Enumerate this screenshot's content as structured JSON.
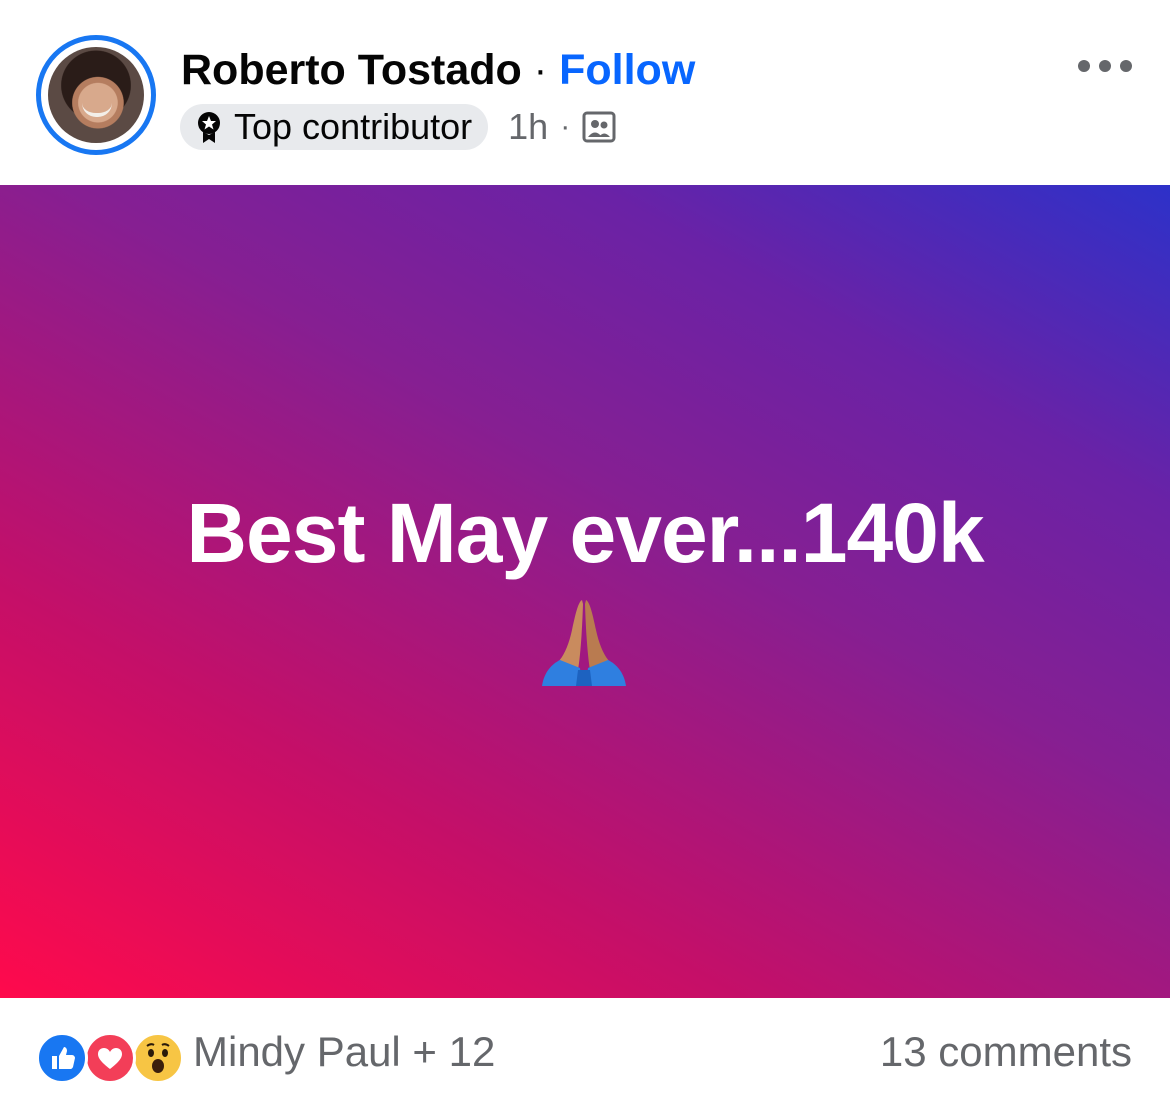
{
  "post": {
    "author": "Roberto Tostado",
    "separator": "·",
    "follow_label": "Follow",
    "badge_label": "Top contributor",
    "time": "1h",
    "meta_separator": "·",
    "audience_icon": "group-icon",
    "more_icon": "more-options-icon",
    "text": "Best May ever...140k",
    "emoji": "🙏",
    "background_colors": [
      "#ff0a4c",
      "#c50f68",
      "#861f92",
      "#6a22a6",
      "#2d31c9"
    ]
  },
  "footer": {
    "reactions": [
      "like-icon",
      "love-icon",
      "wow-icon"
    ],
    "reaction_summary": "Mindy Paul + 12",
    "comments": "13 comments"
  },
  "colors": {
    "accent": "#0866ff",
    "ring": "#1877f2",
    "muted_text": "#65676b"
  }
}
